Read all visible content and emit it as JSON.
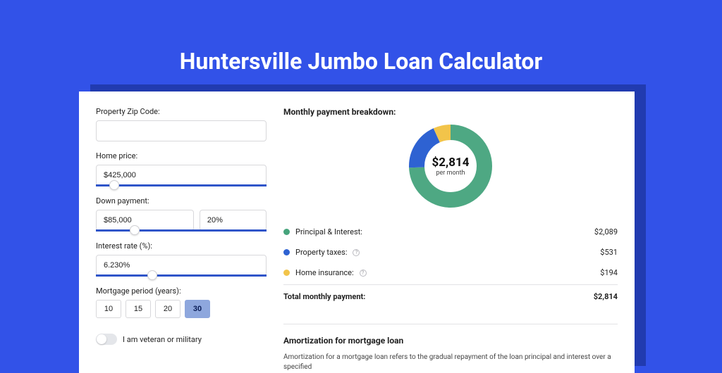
{
  "page": {
    "title": "Huntersville Jumbo Loan Calculator"
  },
  "form": {
    "zip_label": "Property Zip Code:",
    "zip_value": "",
    "home_price_label": "Home price:",
    "home_price_value": "$425,000",
    "home_price_slider_pct": 8,
    "down_label": "Down payment:",
    "down_amount_value": "$85,000",
    "down_percent_value": "20%",
    "down_slider_pct": 20,
    "rate_label": "Interest rate (%):",
    "rate_value": "6.230%",
    "rate_slider_pct": 30,
    "period_label": "Mortgage period (years):",
    "period_options": [
      "10",
      "15",
      "20",
      "30"
    ],
    "period_active_index": 3,
    "veteran_label": "I am veteran or military"
  },
  "breakdown": {
    "title": "Monthly payment breakdown:",
    "total_label": "per month",
    "rows": [
      {
        "name": "Principal & Interest:",
        "value": "$2,089",
        "color": "green",
        "info": false
      },
      {
        "name": "Property taxes:",
        "value": "$531",
        "color": "blue",
        "info": true
      },
      {
        "name": "Home insurance:",
        "value": "$194",
        "color": "yellow",
        "info": true
      }
    ],
    "total_row_label": "Total monthly payment:",
    "total_value": "$2,814"
  },
  "chart_data": {
    "type": "pie",
    "title": "Monthly payment breakdown",
    "center_value": "$2,814",
    "center_sub": "per month",
    "series": [
      {
        "name": "Principal & Interest",
        "value": 2089,
        "color": "#4ea883"
      },
      {
        "name": "Property taxes",
        "value": 531,
        "color": "#2e62d2"
      },
      {
        "name": "Home insurance",
        "value": 194,
        "color": "#f2c44a"
      }
    ],
    "total": 2814
  },
  "amort": {
    "title": "Amortization for mortgage loan",
    "body": "Amortization for a mortgage loan refers to the gradual repayment of the loan principal and interest over a specified"
  }
}
